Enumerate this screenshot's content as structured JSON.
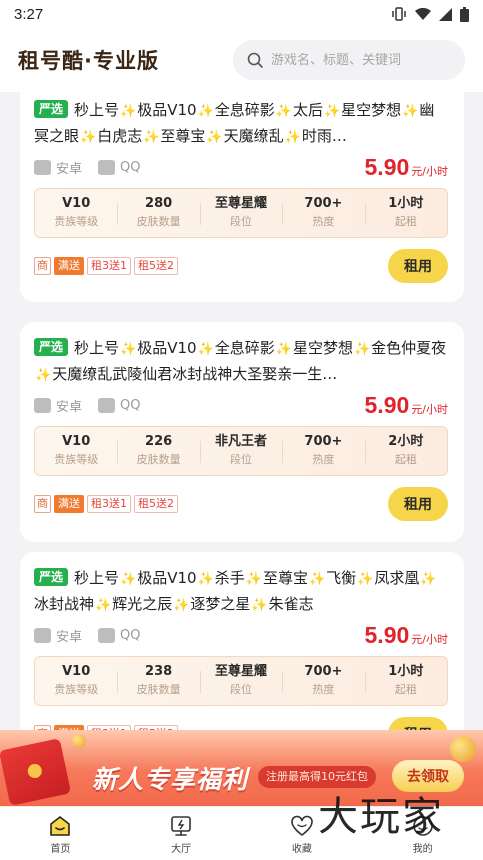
{
  "status_bar": {
    "time": "3:27"
  },
  "header": {
    "brand": "租号酷·专业版",
    "search_placeholder": "游戏名、标题、关键词"
  },
  "cards": [
    {
      "badge": "严选",
      "title_parts": [
        "秒上号",
        "极品V10",
        "全息碎影",
        "太后",
        "星空梦想",
        "幽冥之眼",
        "白虎志",
        "至尊宝",
        "天魔缭乱",
        "时雨…"
      ],
      "platform": "安卓",
      "login": "QQ",
      "price": "5.90",
      "price_unit": "元/小时",
      "stats": [
        {
          "value": "V10",
          "label": "贵族等级"
        },
        {
          "value": "280",
          "label": "皮肤数量"
        },
        {
          "value": "至尊星耀",
          "label": "段位"
        },
        {
          "value": "700+",
          "label": "热度"
        },
        {
          "value": "1小时",
          "label": "起租"
        }
      ],
      "promo": {
        "shang": "商",
        "man": "满送",
        "deals": [
          "租3送1",
          "租5送2"
        ]
      },
      "rent_label": "租用"
    },
    {
      "badge": "严选",
      "title_parts": [
        "秒上号",
        "极品V10",
        "全息碎影",
        "星空梦想",
        "金色仲夏夜",
        "天魔缭乱武陵仙君冰封战神大圣娶亲一生…"
      ],
      "platform": "安卓",
      "login": "QQ",
      "price": "5.90",
      "price_unit": "元/小时",
      "stats": [
        {
          "value": "V10",
          "label": "贵族等级"
        },
        {
          "value": "226",
          "label": "皮肤数量"
        },
        {
          "value": "非凡王者",
          "label": "段位"
        },
        {
          "value": "700+",
          "label": "热度"
        },
        {
          "value": "2小时",
          "label": "起租"
        }
      ],
      "promo": {
        "shang": "商",
        "man": "满送",
        "deals": [
          "租3送1",
          "租5送2"
        ]
      },
      "rent_label": "租用"
    },
    {
      "badge": "严选",
      "title_parts": [
        "秒上号",
        "极品V10",
        "杀手",
        "至尊宝",
        "飞衡",
        "凤求凰",
        "冰封战神",
        "辉光之辰",
        "逐梦之星",
        "朱雀志"
      ],
      "platform": "安卓",
      "login": "QQ",
      "price": "5.90",
      "price_unit": "元/小时",
      "stats": [
        {
          "value": "V10",
          "label": "贵族等级"
        },
        {
          "value": "238",
          "label": "皮肤数量"
        },
        {
          "value": "至尊星耀",
          "label": "段位"
        },
        {
          "value": "700+",
          "label": "热度"
        },
        {
          "value": "1小时",
          "label": "起租"
        }
      ],
      "promo": {
        "shang": "商",
        "man": "满送",
        "deals": [
          "租3送1",
          "租5送2"
        ]
      },
      "rent_label": "租用"
    }
  ],
  "banner": {
    "title": "新人专享福利",
    "subtitle": "注册最高得10元红包",
    "button": "去领取"
  },
  "nav": {
    "items": [
      {
        "label": "首页",
        "icon": "home-icon"
      },
      {
        "label": "大厅",
        "icon": "hall-icon"
      },
      {
        "label": "收藏",
        "icon": "heart-icon"
      },
      {
        "label": "我的",
        "icon": "profile-icon"
      }
    ]
  },
  "watermark": "大玩家",
  "colors": {
    "accent": "#f7d54a",
    "price": "#e0242b",
    "badge": "#25b04f"
  }
}
